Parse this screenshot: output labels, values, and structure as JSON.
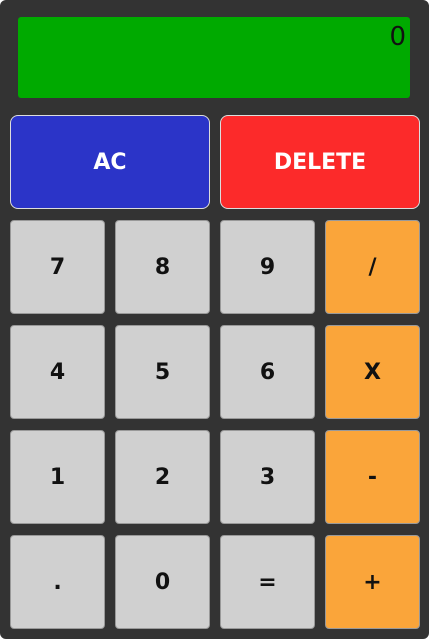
{
  "display": {
    "value": "0"
  },
  "controls": {
    "ac_label": "AC",
    "delete_label": "DELETE"
  },
  "keys": {
    "seven": "7",
    "eight": "8",
    "nine": "9",
    "divide": "/",
    "four": "4",
    "five": "5",
    "six": "6",
    "multiply": "X",
    "one": "1",
    "two": "2",
    "three": "3",
    "subtract": "-",
    "decimal": ".",
    "zero": "0",
    "equals": "=",
    "add": "+"
  },
  "colors": {
    "display": "#00aa00",
    "ac": "#2b34c8",
    "delete": "#fc2a2a",
    "number_key": "#d0d0d0",
    "operator_key": "#faa53a",
    "body": "#333333"
  }
}
